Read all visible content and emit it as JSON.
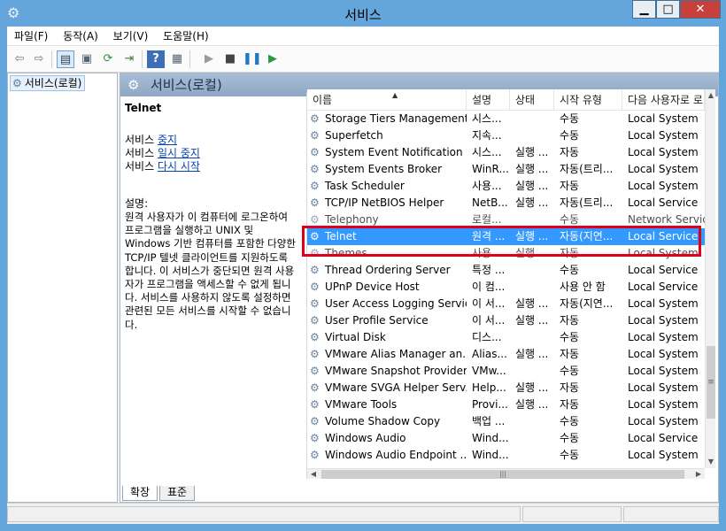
{
  "window": {
    "title": "서비스",
    "buttons": {
      "minimize": "▁",
      "maximize": "□",
      "close": "✕"
    }
  },
  "menu": [
    "파일(F)",
    "동작(A)",
    "보기(V)",
    "도움말(H)"
  ],
  "toolbar": [
    "back-icon",
    "forward-icon",
    "show-hide-console-tree-icon",
    "properties-icon",
    "refresh-icon",
    "export-list-icon",
    "help-icon",
    "show-hide-action-pane-icon",
    "start-service-icon",
    "stop-service-icon",
    "pause-service-icon",
    "resume-service-icon"
  ],
  "tree": {
    "root_label": "서비스(로컬)"
  },
  "main": {
    "header_title": "서비스(로컬)",
    "selected_service": "Telnet",
    "controls": [
      {
        "prefix": "서비스 ",
        "link": "중지"
      },
      {
        "prefix": "서비스 ",
        "link": "일시 중지"
      },
      {
        "prefix": "서비스 ",
        "link": "다시 시작"
      }
    ],
    "description_label": "설명:",
    "description_text": "원격 사용자가 이 컴퓨터에 로그온하여 프로그램을 실행하고 UNIX 및 Windows 기반 컴퓨터를 포함한 다양한 TCP/IP 텔넷 클라이언트를 지원하도록 합니다. 이 서비스가 중단되면 원격 사용자가 프로그램을 액세스할 수 없게 됩니다. 서비스를 사용하지 않도록 설정하면 관련된 모든 서비스를 시작할 수 없습니다."
  },
  "list": {
    "columns": [
      "이름",
      "설명",
      "상태",
      "시작 유형",
      "다음 사용자로 로"
    ],
    "rows": [
      [
        "Storage Tiers Management",
        "시스...",
        "",
        "수동",
        "Local System"
      ],
      [
        "Superfetch",
        "지속...",
        "",
        "수동",
        "Local System"
      ],
      [
        "System Event Notification ...",
        "시스...",
        "실행 ...",
        "자동",
        "Local System"
      ],
      [
        "System Events Broker",
        "WinR...",
        "실행 ...",
        "자동(트리...",
        "Local System"
      ],
      [
        "Task Scheduler",
        "사용...",
        "실행 ...",
        "자동",
        "Local System"
      ],
      [
        "TCP/IP NetBIOS Helper",
        "NetB...",
        "실행 ...",
        "자동(트리...",
        "Local Service"
      ],
      [
        "Telephony",
        "로컬...",
        "",
        "수동",
        "Network Service"
      ],
      [
        "Telnet",
        "원격 ...",
        "실행 ...",
        "자동(지연...",
        "Local Service"
      ],
      [
        "Themes",
        "사용...",
        "실행 ...",
        "자동",
        "Local System"
      ],
      [
        "Thread Ordering Server",
        "특정 ...",
        "",
        "수동",
        "Local Service"
      ],
      [
        "UPnP Device Host",
        "이 컴...",
        "",
        "사용 안 함",
        "Local Service"
      ],
      [
        "User Access Logging Service",
        "이 서...",
        "실행 ...",
        "자동(지연...",
        "Local System"
      ],
      [
        "User Profile Service",
        "이 서...",
        "실행 ...",
        "자동",
        "Local System"
      ],
      [
        "Virtual Disk",
        "디스...",
        "",
        "수동",
        "Local System"
      ],
      [
        "VMware Alias Manager an...",
        "Alias...",
        "실행 ...",
        "자동",
        "Local System"
      ],
      [
        "VMware Snapshot Provider",
        "VMw...",
        "",
        "수동",
        "Local System"
      ],
      [
        "VMware SVGA Helper Serv...",
        "Help...",
        "실행 ...",
        "자동",
        "Local System"
      ],
      [
        "VMware Tools",
        "Provi...",
        "실행 ...",
        "자동",
        "Local System"
      ],
      [
        "Volume Shadow Copy",
        "백업 ...",
        "",
        "수동",
        "Local System"
      ],
      [
        "Windows Audio",
        "Wind...",
        "",
        "수동",
        "Local Service"
      ],
      [
        "Windows Audio Endpoint ...",
        "Wind...",
        "",
        "수동",
        "Local System"
      ]
    ],
    "selected_index": 7,
    "sort_indicator": "▲"
  },
  "tabs": [
    "확장",
    "표준"
  ],
  "colors": {
    "title_bar": "#64a5db",
    "selection": "#3399ff",
    "highlight_box": "#e0001b"
  }
}
